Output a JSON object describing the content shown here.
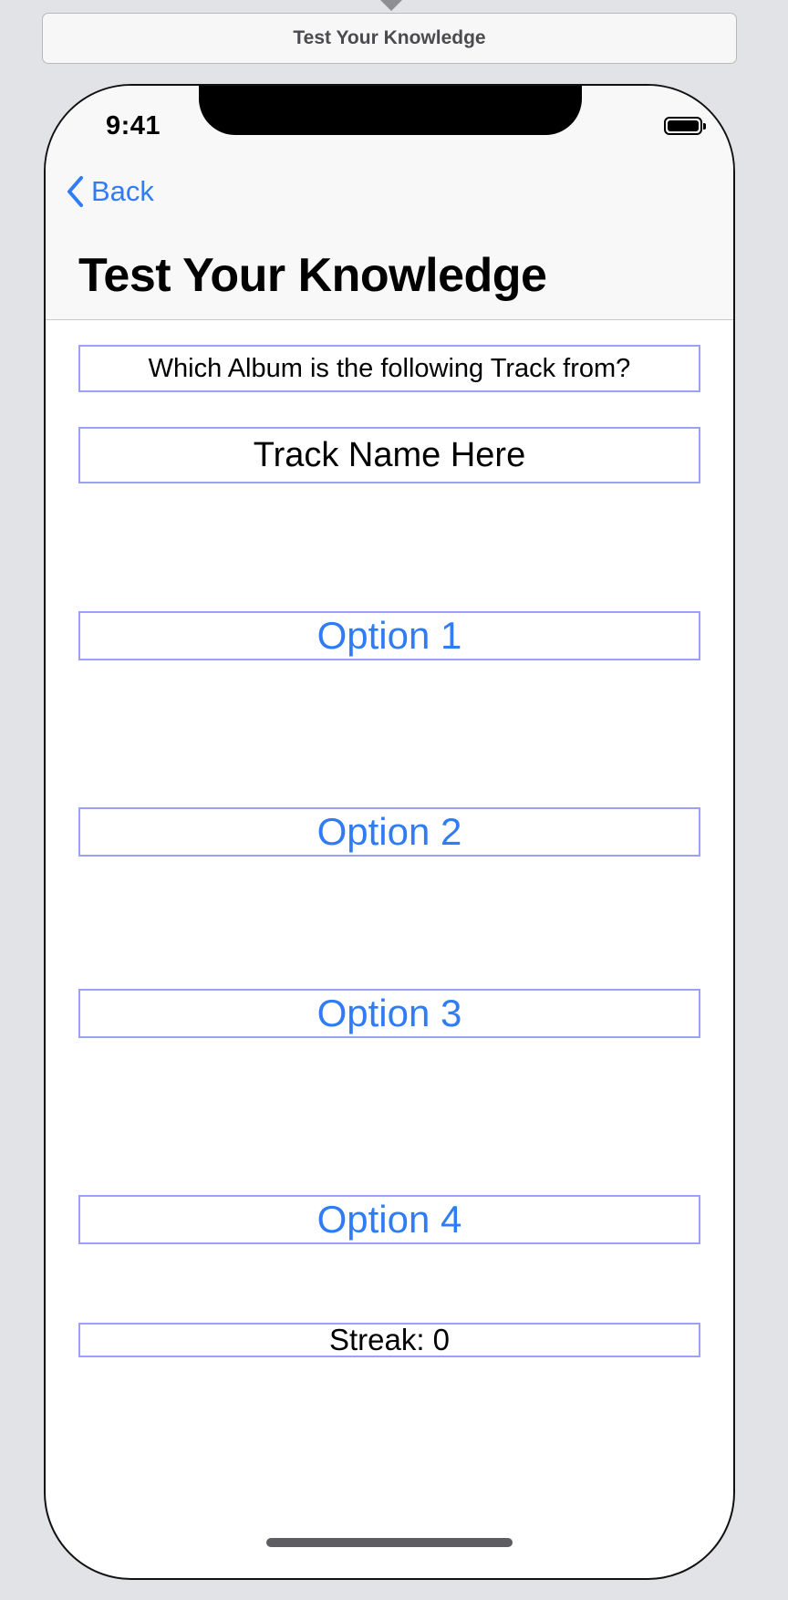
{
  "scene": {
    "title": "Test Your Knowledge"
  },
  "status": {
    "time": "9:41"
  },
  "nav": {
    "back_label": "Back",
    "title": "Test Your Knowledge"
  },
  "quiz": {
    "question": "Which Album is the following Track from?",
    "track_name": "Track Name Here",
    "options": [
      "Option 1",
      "Option 2",
      "Option 3",
      "Option 4"
    ],
    "streak": "Streak: 0"
  },
  "colors": {
    "accent": "#2f7cf6",
    "frame_outline": "#9ca0f6",
    "canvas": "#e2e3e7"
  },
  "icons": {
    "back": "chevron-left-icon",
    "battery": "battery-icon"
  }
}
